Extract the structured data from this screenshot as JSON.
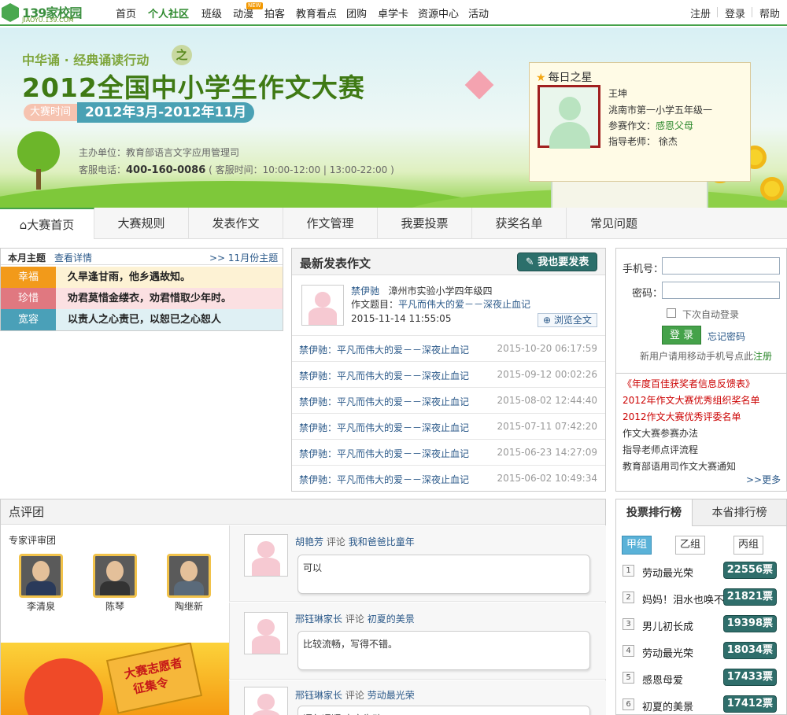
{
  "logo": {
    "text": "139家校园",
    "sub": "JIAOYU.139.COM"
  },
  "nav": [
    {
      "label": "首页",
      "active": false
    },
    {
      "label": "个人社区",
      "active": true
    },
    {
      "label": "班级",
      "active": false
    },
    {
      "label": "动漫",
      "active": false,
      "badge": "NEW"
    },
    {
      "label": "拍客",
      "active": false
    },
    {
      "label": "教育看点",
      "active": false
    },
    {
      "label": "团购",
      "active": false
    },
    {
      "label": "卓学卡",
      "active": false
    },
    {
      "label": "资源中心",
      "active": false
    },
    {
      "label": "活动",
      "active": false
    }
  ],
  "toplinks": {
    "register": "注册",
    "login": "登录",
    "help": "帮助"
  },
  "banner": {
    "slogan": "中华诵 · 经典诵读行动",
    "zhi": "之",
    "title": "2012全国中小学生作文大赛",
    "date_label": "大赛时间",
    "date_value": "2012年3月-2012年11月",
    "organizer": "主办单位：教育部语言文字应用管理司",
    "phone_prefix": "客服电话：",
    "phone": "400-160-0086",
    "hours": "( 客服时间：10:00-12:00 | 13:00-22:00 )"
  },
  "star": {
    "title": "每日之星",
    "name": "王坤",
    "school": "洮南市第一小学五年级一",
    "essay_label": "参赛作文：",
    "essay": "感恩父母",
    "teacher_label": "指导老师：",
    "teacher": "徐杰"
  },
  "tabs": [
    "大赛首页",
    "大赛规则",
    "发表作文",
    "作文管理",
    "我要投票",
    "获奖名单",
    "常见问题"
  ],
  "theme": {
    "title": "本月主题",
    "detail": "查看详情",
    "next": ">> 11月份主题",
    "rows": [
      {
        "label": "幸福",
        "text": "久旱逢甘雨，他乡遇故知。",
        "color": "#f29a1a",
        "bg": "#fdf2d4"
      },
      {
        "label": "珍惜",
        "text": "劝君莫惜金缕衣，劝君惜取少年时。",
        "color": "#e07880",
        "bg": "#fbe0e2"
      },
      {
        "label": "宽容",
        "text": "以责人之心责已，以恕已之心恕人",
        "color": "#4aa0b8",
        "bg": "#dff0f4"
      }
    ]
  },
  "latest": {
    "title": "最新发表作文",
    "publish": "我也要发表",
    "featured": {
      "author": "禁伊驰",
      "school": "漳州市实验小学四年级四",
      "essay_label": "作文题目：",
      "essay": "平凡而伟大的爱－－深夜止血记",
      "date": "2015-11-14 11:55:05",
      "browse": "浏览全文"
    },
    "list": [
      {
        "title": "禁伊驰：平凡而伟大的爱－－深夜止血记",
        "date": "2015-10-20 06:17:59"
      },
      {
        "title": "禁伊驰：平凡而伟大的爱－－深夜止血记",
        "date": "2015-09-12 00:02:26"
      },
      {
        "title": "禁伊驰：平凡而伟大的爱－－深夜止血记",
        "date": "2015-08-02 12:44:40"
      },
      {
        "title": "禁伊驰：平凡而伟大的爱－－深夜止血记",
        "date": "2015-07-11 07:42:20"
      },
      {
        "title": "禁伊驰：平凡而伟大的爱－－深夜止血记",
        "date": "2015-06-23 14:27:09"
      },
      {
        "title": "禁伊驰：平凡而伟大的爱－－深夜止血记",
        "date": "2015-06-02 10:49:34"
      }
    ]
  },
  "login": {
    "phone_label": "手机号：",
    "password_label": "密码：",
    "remember": "下次自动登录",
    "submit": "登 录",
    "forgot": "忘记密码",
    "register_hint": "新用户请用移动手机号点此",
    "register_link": "注册"
  },
  "news": [
    {
      "text": "《年度百佳获奖者信息反馈表》",
      "red": true
    },
    {
      "text": "2012年作文大赛优秀组织奖名单",
      "red": true
    },
    {
      "text": "2012作文大赛优秀评委名单",
      "red": true
    },
    {
      "text": "作文大赛参赛办法",
      "red": false
    },
    {
      "text": "指导老师点评流程",
      "red": false
    },
    {
      "text": "教育部语用司作文大赛通知",
      "red": false
    }
  ],
  "news_more": ">>更多",
  "review": {
    "title": "点评团",
    "experts_title": "专家评审团",
    "experts": [
      "李清泉",
      "陈琴",
      "陶继新"
    ],
    "volunteer": [
      "大赛志愿者",
      "征集令"
    ],
    "comments": [
      {
        "name": "胡艳芳",
        "verb": "评论",
        "essay": "我和爸爸比童年",
        "text": "可以"
      },
      {
        "name": "邢钰琳家长",
        "verb": "评论",
        "essay": "初夏的美景",
        "text": "比较流畅，写得不错。"
      },
      {
        "name": "邢钰琳家长",
        "verb": "评论",
        "essay": "劳动最光荣",
        "text": "语句通顺 内容生动"
      }
    ]
  },
  "rank": {
    "tabs": [
      "投票排行榜",
      "本省排行榜"
    ],
    "groups": [
      "甲组",
      "乙组",
      "丙组"
    ],
    "items": [
      {
        "n": "1",
        "name": "劳动最光荣",
        "votes": "22556票"
      },
      {
        "n": "2",
        "name": "妈妈！泪水也唤不回",
        "votes": "21821票"
      },
      {
        "n": "3",
        "name": "男儿初长成",
        "votes": "19398票"
      },
      {
        "n": "4",
        "name": "劳动最光荣",
        "votes": "18034票"
      },
      {
        "n": "5",
        "name": "感恩母爱",
        "votes": "17433票"
      },
      {
        "n": "6",
        "name": "初夏的美景",
        "votes": "17412票"
      }
    ]
  }
}
